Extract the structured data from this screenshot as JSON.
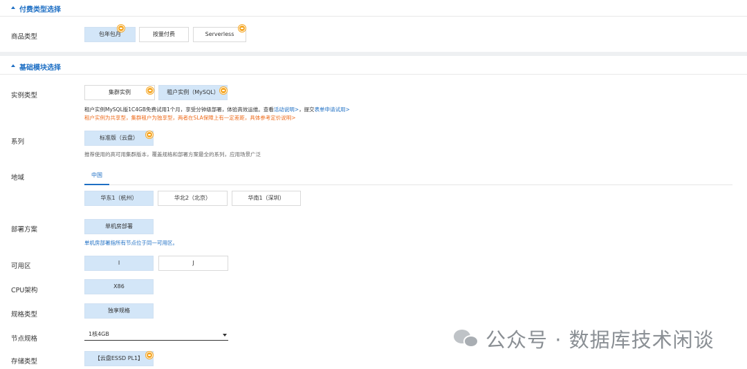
{
  "billing": {
    "section_title": "付费类型选择",
    "product_type_label": "商品类型",
    "options": [
      "包年包月",
      "按量付费",
      "Serverless"
    ]
  },
  "basic": {
    "section_title": "基础模块选择",
    "instance_type_label": "实例类型",
    "instance_options": [
      "集群实例",
      "租户实例（MySQL）"
    ],
    "instance_note1_prefix": "租户实例MySQL版1C4GB免费试用1个月，享受分钟级部署，体验高效运维。查看",
    "instance_note1_link1": "活动说明>",
    "instance_note1_mid": "，提交",
    "instance_note1_link2": "表单申请试用>",
    "instance_note2": "租户实例为共享型，集群租户为独享型，两者在SLA保障上有一定差距，具体参考定价说明>",
    "series_label": "系列",
    "series_option": "标准版（云盘）",
    "series_note": "推荐使用的高可用集群版本，覆盖规格和部署方案最全的系列，应用场景广泛",
    "region_label": "地域",
    "region_tab": "中国",
    "region_options": [
      "华东1（杭州）",
      "华北2（北京）",
      "华南1（深圳）"
    ],
    "deploy_label": "部署方案",
    "deploy_option": "单机房部署",
    "deploy_note": "单机房部署指所有节点位于同一可用区。",
    "zone_label": "可用区",
    "zone_options": [
      "I",
      "J"
    ],
    "cpu_label": "CPU架构",
    "cpu_option": "X86",
    "spec_type_label": "规格类型",
    "spec_type_option": "独享规格",
    "node_spec_label": "节点规格",
    "node_spec_value": "1核4GB",
    "storage_label": "存储类型",
    "storage_option": "【云盘ESSD PL1】"
  },
  "watermark": {
    "text": "公众号 · 数据库技术闲谈"
  },
  "colors": {
    "accent": "#1e6fc4",
    "selected_bg": "#d3e6f8",
    "badge": "#f5a623",
    "warning_text": "#ee6d1e"
  }
}
